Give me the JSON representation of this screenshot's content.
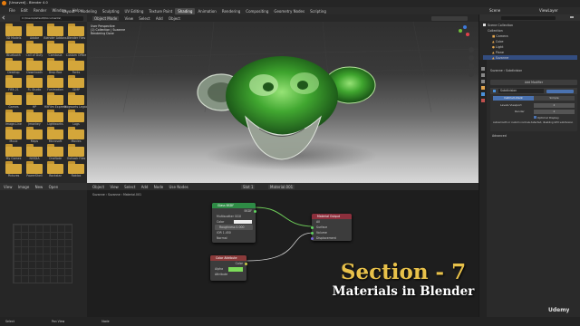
{
  "window": {
    "title": "[Unsaved] - Blender 4.0"
  },
  "menu": [
    "File",
    "Edit",
    "Render",
    "Window",
    "Help"
  ],
  "workspace_tabs": [
    {
      "label": "Layout",
      "active": false
    },
    {
      "label": "Modeling",
      "active": false
    },
    {
      "label": "Sculpting",
      "active": false
    },
    {
      "label": "UV Editing",
      "active": false
    },
    {
      "label": "Texture Paint",
      "active": false
    },
    {
      "label": "Shading",
      "active": true
    },
    {
      "label": "Animation",
      "active": false
    },
    {
      "label": "Rendering",
      "active": false
    },
    {
      "label": "Compositing",
      "active": false
    },
    {
      "label": "Geometry Nodes",
      "active": false
    },
    {
      "label": "Scripting",
      "active": false
    }
  ],
  "scene": {
    "name": "Scene",
    "view_layer": "ViewLayer"
  },
  "file_browser": {
    "path": "C:\\Users\\default\\Documents\\",
    "folders": [
      "3D Models",
      "Adobe",
      "Blender Addons",
      "Blender Files",
      "Bluetooth",
      "Call of Duty",
      "Camtasia",
      "Custom Office",
      "Desktop",
      "Downloads",
      "Drop Box",
      "Fonts",
      "FIFA 21",
      "FL Studio",
      "Funimation",
      "GIMP",
      "Games",
      "HP",
      "HitFilm Express",
      "Hogwarts Legacy",
      "Image-Line",
      "Jmonkey",
      "Lightworks",
      "Logs",
      "Music",
      "Maps",
      "Microsoft",
      "Movies",
      "My Games",
      "NVIDIA",
      "OneNote",
      "Outlook Files",
      "Pictures",
      "PowerShell",
      "Rockstar",
      "Roblox"
    ]
  },
  "viewport": {
    "header_items": [
      "Object Mode",
      "View",
      "Select",
      "Add",
      "Object"
    ],
    "overlay_lines": [
      "User Perspective",
      "(1) Collection | Suzanne",
      "Rendering Done"
    ]
  },
  "shader_editor": {
    "header_items": [
      "Object",
      "View",
      "Select",
      "Add",
      "Node",
      "Use Nodes"
    ],
    "slot": "Slot 1",
    "material": "Material.001",
    "breadcrumb": [
      "Suzanne",
      "Suzanne",
      "Material.001"
    ],
    "nodes": {
      "glass": {
        "title": "Glass BSDF",
        "output": "BSDF",
        "rows": [
          "Multiscatter GGX",
          "Color",
          "Roughness  0.000",
          "IOR  1.450",
          "Normal"
        ]
      },
      "output": {
        "title": "Material Output",
        "target": "All",
        "rows": [
          "Surface",
          "Volume",
          "Displacement"
        ]
      },
      "attrib": {
        "title": "Color Attribute",
        "rows": [
          "Color",
          "Alpha",
          "Color",
          "Attribute"
        ],
        "color": "#7ddc5a"
      }
    }
  },
  "image_editor": {
    "header_items": [
      "View",
      "Image",
      "New",
      "Open"
    ]
  },
  "outliner": {
    "title": "Scene Collection",
    "items": [
      "Collection",
      "Camera",
      "Cube",
      "Light",
      "Plane",
      "Suzanne"
    ]
  },
  "properties": {
    "panel_title": "Subdivision",
    "modifier_title": "Add Modifier",
    "modifier_name": "Subdivision",
    "mode_tabs": [
      "Catmull-Clark",
      "Simple"
    ],
    "fields": [
      {
        "label": "Levels Viewport",
        "value": "2"
      },
      {
        "label": "Render",
        "value": "2"
      }
    ],
    "checkbox_label": "Optimal Display",
    "note": "Autosmooth or custom normals detected, disabling GPU subdivision",
    "advanced": "Advanced"
  },
  "status_bar": [
    "Select",
    "Pan View",
    "Node"
  ],
  "overlay_title": {
    "line1": "Section - 7",
    "line2": "Materials in Blender",
    "color": "#e8c14a"
  },
  "brand": "Udemy"
}
